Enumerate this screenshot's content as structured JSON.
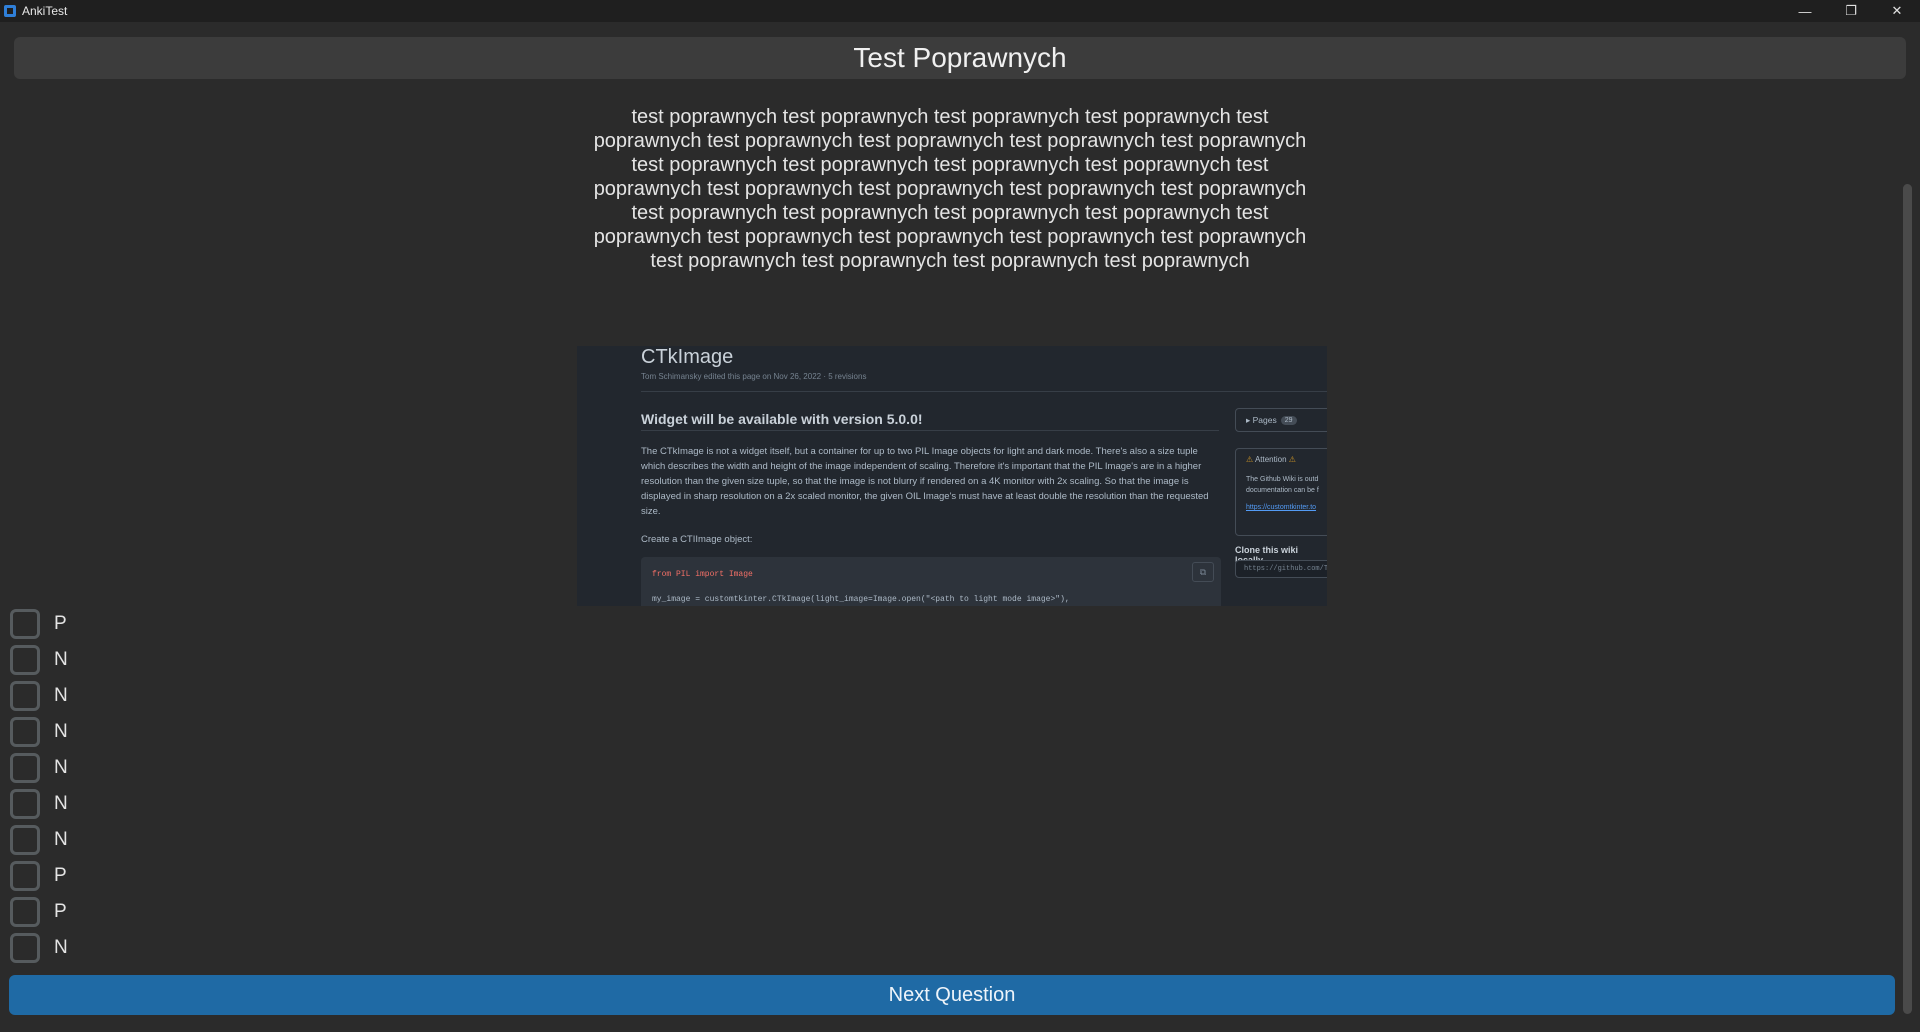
{
  "window": {
    "title": "AnkiTest",
    "controls": {
      "minimize": "—",
      "restore": "❐",
      "close": "✕"
    }
  },
  "header": {
    "title": "Test Poprawnych"
  },
  "question": {
    "text": "test poprawnych test poprawnych test poprawnych test poprawnych test poprawnych test poprawnych test poprawnych test poprawnych test poprawnych test poprawnych test poprawnych test poprawnych test poprawnych test poprawnych test poprawnych test poprawnych test poprawnych test poprawnych test poprawnych test poprawnych test poprawnych test poprawnych test poprawnych test poprawnych test poprawnych test poprawnych test poprawnych test poprawnych test poprawnych test poprawnych test poprawnych"
  },
  "image": {
    "page_title": "CTkImage",
    "meta": "Tom Schimansky edited this page on Nov 26, 2022 · 5 revisions",
    "heading": "Widget will be available with version 5.0.0!",
    "paragraph": "The CTkImage is not a widget itself, but a container for up to two PIL Image objects for light and dark mode. There's also a size tuple which describes the width and height of the image independent of scaling. Therefore it's important that the PIL Image's are in a higher resolution than the given size tuple, so that the image is not blurry if rendered on a 4K monitor with 2x scaling. So that the image is displayed in sharp resolution on a 2x scaled monitor, the given OIL Image's must have at least double the resolution than the requested size.",
    "create_text": "Create a CTIImage object:",
    "code_line1": "from PIL import Image",
    "code_line2": "my_image = customtkinter.CTkImage(light_image=Image.open(\"<path to light mode image>\"),",
    "pages_label": "Pages",
    "pages_count": "29",
    "attention_label": "Attention",
    "attention_text": "The Github Wiki is outd documentation can be f",
    "attention_link": "https://customtkinter.to",
    "clone_label": "Clone this wiki locally",
    "clone_url": "https://github.com/T"
  },
  "options": [
    {
      "label": "P",
      "checked": false
    },
    {
      "label": "N",
      "checked": false
    },
    {
      "label": "N",
      "checked": false
    },
    {
      "label": "N",
      "checked": false
    },
    {
      "label": "N",
      "checked": false
    },
    {
      "label": "N",
      "checked": false
    },
    {
      "label": "N",
      "checked": false
    },
    {
      "label": "P",
      "checked": false
    },
    {
      "label": "P",
      "checked": false
    },
    {
      "label": "N",
      "checked": false
    }
  ],
  "next_button": {
    "label": "Next Question"
  },
  "colors": {
    "accent": "#1f6aa5",
    "background": "#2b2b2b",
    "header": "#3c3c3c"
  }
}
